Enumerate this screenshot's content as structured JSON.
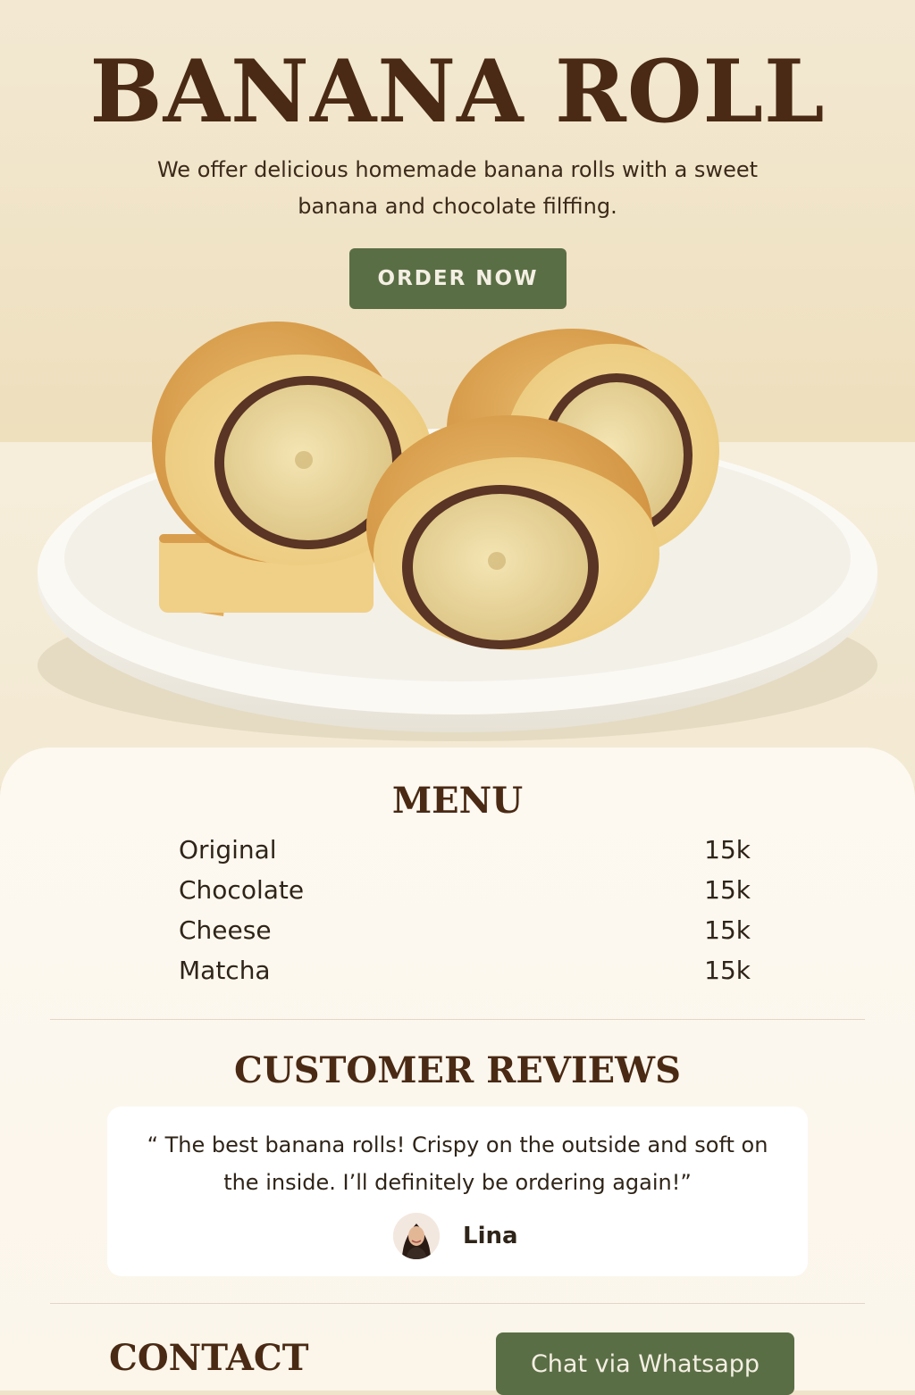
{
  "hero": {
    "title": "BANANA ROLL",
    "subtitle": "We offer delicious homemade banana rolls with a sweet banana and chocolate filffing.",
    "order_button": "ORDER NOW"
  },
  "menu": {
    "title": "MENU",
    "items": [
      {
        "name": "Original",
        "price": "15k"
      },
      {
        "name": "Chocolate",
        "price": "15k"
      },
      {
        "name": "Cheese",
        "price": "15k"
      },
      {
        "name": "Matcha",
        "price": "15k"
      }
    ]
  },
  "reviews": {
    "title": "CUSTOMER REVIEWS",
    "quote": "“ The best banana rolls! Crispy on the outside and soft on the inside. I’ll definitely be ordering again!”",
    "reviewer": "Lina"
  },
  "contact": {
    "title": "CONTACT",
    "whatsapp_button": "Chat via Whatsapp"
  },
  "colors": {
    "brand_green": "#5a6e45",
    "heading_brown": "#4a2a14",
    "cream": "#fdf9f1"
  }
}
